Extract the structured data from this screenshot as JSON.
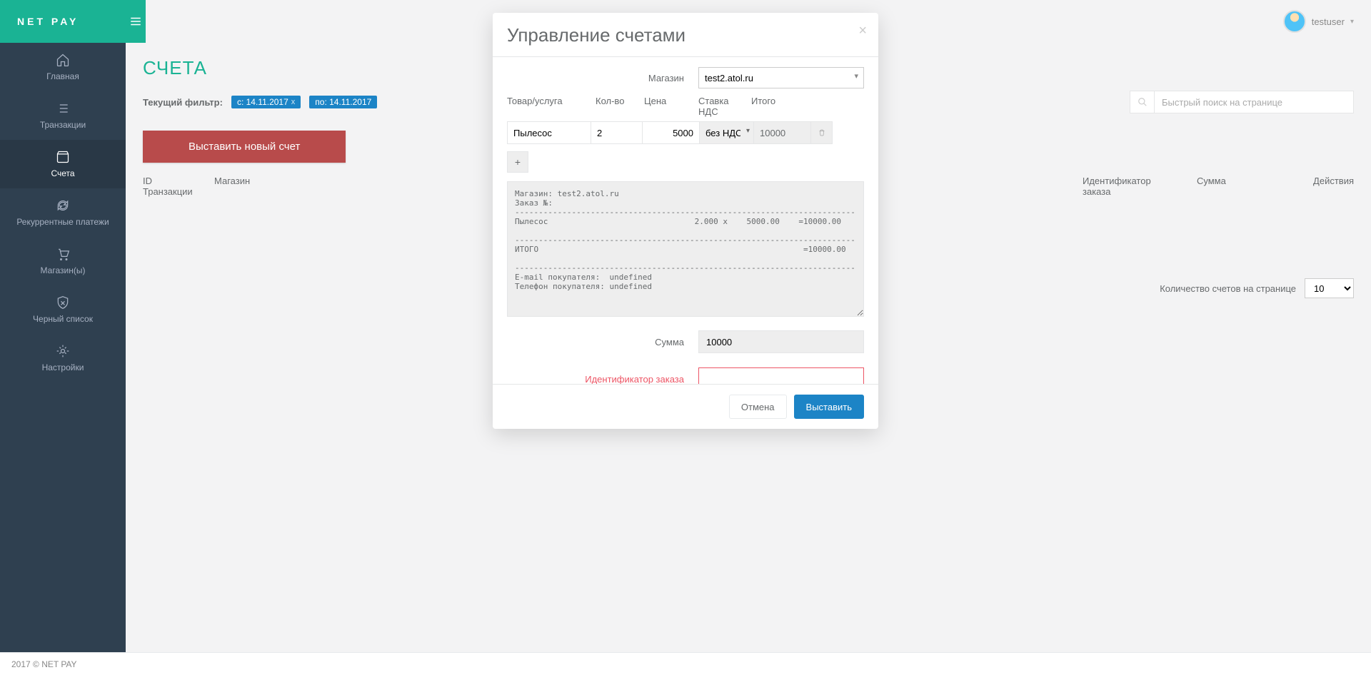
{
  "brand": "NET PAY",
  "user": {
    "name": "testuser"
  },
  "sidebar": {
    "items": [
      {
        "label": "Главная"
      },
      {
        "label": "Транзакции"
      },
      {
        "label": "Счета"
      },
      {
        "label": "Рекуррентные платежи"
      },
      {
        "label": "Магазин(ы)"
      },
      {
        "label": "Черный список"
      },
      {
        "label": "Настройки"
      }
    ]
  },
  "page": {
    "title": "СЧЕТА",
    "filter_label": "Текущий фильтр:",
    "filter_from": "с: 14.11.2017",
    "filter_to": "по: 14.11.2017",
    "search_placeholder": "Быстрый поиск на странице",
    "new_invoice_btn": "Выставить новый счет",
    "cols": {
      "id": "ID\nТранзакции",
      "shop": "Магазин",
      "ord": "Идентификатор\nзаказа",
      "sum": "Сумма",
      "act": "Действия"
    },
    "per_page_label": "Количество счетов на странице",
    "per_page_value": "10"
  },
  "footer": {
    "text": "2017 © NET PAY"
  },
  "modal": {
    "title": "Управление счетами",
    "shop_label": "Магазин",
    "shop_value": "test2.atol.ru",
    "cols": {
      "item": "Товар/услуга",
      "qty": "Кол-во",
      "price": "Цена",
      "vat": "Ставка\nНДС",
      "total": "Итого"
    },
    "line": {
      "item": "Пылесос",
      "qty": "2",
      "price": "5000",
      "vat": "без НДС",
      "total": "10000"
    },
    "summary_text": "Магазин: test2.atol.ru\nЗаказ №:\n------------------------------------------------------------------------\nПылесос                               2.000 x    5000.00    =10000.00\n\n------------------------------------------------------------------------\nИТОГО                                                        =10000.00\n\n------------------------------------------------------------------------\nE-mail покупателя:  undefined\nТелефон покупателя: undefined",
    "sum_label": "Сумма",
    "sum_value": "10000",
    "order_id_label": "Идентификатор заказа",
    "order_id_value": "",
    "add_btn": "+",
    "cancel": "Отмена",
    "submit": "Выставить"
  }
}
